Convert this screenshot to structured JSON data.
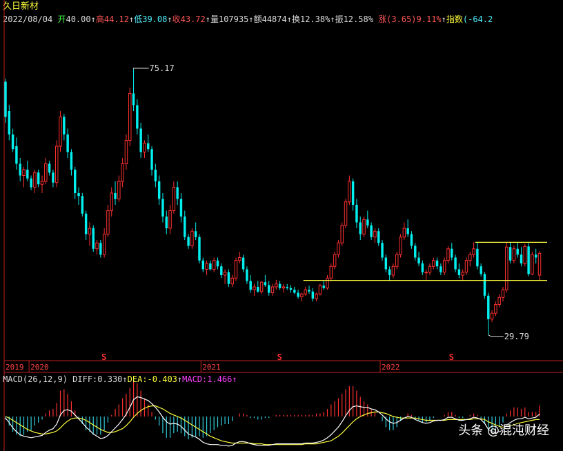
{
  "stock_name": "久日新材",
  "quote": [
    {
      "text": "2022/08/04",
      "cls": "w"
    },
    {
      "text": " 开",
      "cls": "g"
    },
    {
      "text": "40.00",
      "cls": "w"
    },
    {
      "text": "↑",
      "cls": "w"
    },
    {
      "text": "高",
      "cls": "r"
    },
    {
      "text": "44.12",
      "cls": "r"
    },
    {
      "text": "↑",
      "cls": "w"
    },
    {
      "text": "低",
      "cls": "c"
    },
    {
      "text": "39.08",
      "cls": "c"
    },
    {
      "text": "↑",
      "cls": "w"
    },
    {
      "text": "收",
      "cls": "r"
    },
    {
      "text": "43.72",
      "cls": "r"
    },
    {
      "text": "↑",
      "cls": "w"
    },
    {
      "text": "量",
      "cls": "w"
    },
    {
      "text": "107935",
      "cls": "w"
    },
    {
      "text": "↑",
      "cls": "w"
    },
    {
      "text": "额",
      "cls": "w"
    },
    {
      "text": "44874",
      "cls": "w"
    },
    {
      "text": "↑",
      "cls": "w"
    },
    {
      "text": "换",
      "cls": "w"
    },
    {
      "text": "12.38%",
      "cls": "w"
    },
    {
      "text": "↑",
      "cls": "w"
    },
    {
      "text": "振",
      "cls": "w"
    },
    {
      "text": "12.58%",
      "cls": "w"
    },
    {
      "text": " 涨",
      "cls": "r"
    },
    {
      "text": "(3.65)9.11%",
      "cls": "r"
    },
    {
      "text": "↑",
      "cls": "w"
    },
    {
      "text": "指数",
      "cls": "y"
    },
    {
      "text": "(-64.2",
      "cls": "c"
    }
  ],
  "macd_header": [
    {
      "text": "MACD(26,12,9)",
      "cls": "w"
    },
    {
      "text": " DIFF:0.330",
      "cls": "w"
    },
    {
      "text": "↑",
      "cls": "w"
    },
    {
      "text": "DEA:-0.403",
      "cls": "y"
    },
    {
      "text": "↑",
      "cls": "w"
    },
    {
      "text": "MACD:1.466",
      "cls": "m"
    },
    {
      "text": "↑",
      "cls": "m"
    }
  ],
  "watermark": "头条 @混沌财经",
  "colors": {
    "up": "#ff3030",
    "down": "#00f0f0",
    "dea": "#ffff3c",
    "diff": "#ffffff",
    "axis": "#c02020",
    "support": "#ffff3c",
    "hist_up": "#ff3030",
    "hist_down": "#30d0e0"
  },
  "chart_data": {
    "type": "candlestick",
    "annotations": {
      "high_label": "75.17",
      "low_label": "29.79"
    },
    "year_labels": [
      "2019",
      "2020",
      "2021",
      "2022"
    ],
    "signal_glyph": "S",
    "price_range": [
      26,
      82
    ],
    "horizontal_lines": [
      {
        "value": 39.1,
        "from_index": 82
      },
      {
        "value": 45.6,
        "from_index": 129
      }
    ],
    "candles": [
      [
        73,
        73.5,
        66,
        67
      ],
      [
        68,
        69,
        63,
        64
      ],
      [
        64,
        65,
        61,
        61.5
      ],
      [
        62,
        63.5,
        58,
        59
      ],
      [
        59,
        60,
        56,
        57
      ],
      [
        57,
        58.5,
        55,
        58
      ],
      [
        58,
        59.5,
        56,
        56.5
      ],
      [
        56.5,
        57,
        54.5,
        55
      ],
      [
        55,
        58,
        54,
        57.5
      ],
      [
        57.5,
        58,
        55,
        55.5
      ],
      [
        55.5,
        57,
        54,
        56
      ],
      [
        56,
        60,
        55.5,
        59
      ],
      [
        59,
        59.5,
        57,
        57.5
      ],
      [
        57.5,
        58,
        55,
        55.8
      ],
      [
        55.8,
        63,
        55,
        62
      ],
      [
        62,
        68,
        61,
        67
      ],
      [
        67,
        67.5,
        63,
        64
      ],
      [
        64,
        65,
        60,
        61
      ],
      [
        61,
        61.5,
        57,
        58
      ],
      [
        58,
        58.5,
        53,
        54
      ],
      [
        54,
        55,
        52,
        53.5
      ],
      [
        53.5,
        54,
        50,
        50.5
      ],
      [
        50.5,
        51,
        46,
        47
      ],
      [
        47,
        49,
        45,
        48
      ],
      [
        48,
        48.5,
        44,
        44.5
      ],
      [
        44.5,
        46,
        43.5,
        45.5
      ],
      [
        45.5,
        46,
        43,
        43.5
      ],
      [
        43.5,
        48,
        43,
        47
      ],
      [
        47,
        52,
        46.5,
        51
      ],
      [
        51,
        55,
        50,
        54
      ],
      [
        54,
        56,
        52,
        53
      ],
      [
        53,
        57,
        52.5,
        56
      ],
      [
        56,
        60,
        55,
        59
      ],
      [
        59,
        64,
        58,
        63
      ],
      [
        63,
        72,
        62,
        71
      ],
      [
        71,
        75.17,
        68,
        69
      ],
      [
        69,
        70,
        64,
        65
      ],
      [
        65,
        66,
        60,
        61
      ],
      [
        61,
        63,
        60,
        62.5
      ],
      [
        62.5,
        64,
        61,
        61.5
      ],
      [
        61.5,
        62,
        57,
        58
      ],
      [
        58,
        59,
        55,
        56
      ],
      [
        56,
        57,
        52,
        53
      ],
      [
        53,
        54,
        49,
        50
      ],
      [
        50,
        51,
        47,
        48
      ],
      [
        48,
        52,
        47,
        51
      ],
      [
        51,
        56,
        50.5,
        55
      ],
      [
        55,
        56,
        52,
        53
      ],
      [
        53,
        54,
        49,
        50
      ],
      [
        50,
        51,
        46,
        46.5
      ],
      [
        46.5,
        47,
        44.5,
        45
      ],
      [
        45,
        48,
        44.5,
        47.5
      ],
      [
        47.5,
        49,
        46,
        46.5
      ],
      [
        46.5,
        47,
        42,
        42.5
      ],
      [
        42.5,
        43,
        40.5,
        41
      ],
      [
        41,
        42.5,
        40,
        42
      ],
      [
        42,
        42.5,
        40.8,
        41
      ],
      [
        41,
        43,
        40.5,
        42.5
      ],
      [
        42.5,
        43,
        41,
        41.5
      ],
      [
        41.5,
        42,
        39.5,
        40
      ],
      [
        40,
        41,
        38.5,
        40.5
      ],
      [
        40.5,
        41,
        38,
        38.5
      ],
      [
        38.5,
        40,
        38,
        39.5
      ],
      [
        39.5,
        43,
        39,
        42.5
      ],
      [
        42.5,
        44,
        42,
        43
      ],
      [
        43,
        43.5,
        40.5,
        41
      ],
      [
        41,
        41.5,
        38.5,
        39
      ],
      [
        39,
        40,
        37,
        37.5
      ],
      [
        37.5,
        38.5,
        36.5,
        38
      ],
      [
        38,
        39,
        37,
        37.2
      ],
      [
        37.2,
        39,
        36.8,
        38.8
      ],
      [
        38.8,
        40,
        38,
        38.3
      ],
      [
        38.3,
        39,
        36.5,
        37
      ],
      [
        37,
        38.5,
        36.5,
        38
      ],
      [
        38,
        39.2,
        37.5,
        38.5
      ],
      [
        38.5,
        39,
        37.5,
        37.8
      ],
      [
        37.8,
        38.5,
        37,
        38
      ],
      [
        38,
        38.5,
        37.5,
        37.8
      ],
      [
        37.8,
        38.3,
        37,
        37.5
      ],
      [
        37.5,
        38,
        36.8,
        37
      ],
      [
        37,
        37.5,
        36,
        36.3
      ],
      [
        36.3,
        37,
        35.5,
        36.8
      ],
      [
        36.8,
        38,
        36.5,
        37.5
      ],
      [
        37.5,
        38.2,
        36.8,
        37.2
      ],
      [
        37.2,
        37.8,
        35.5,
        36
      ],
      [
        36,
        37,
        35.5,
        36.8
      ],
      [
        36.8,
        38.5,
        36.5,
        38.2
      ],
      [
        38.2,
        39,
        37.5,
        37.8
      ],
      [
        37.8,
        40,
        37.5,
        39.5
      ],
      [
        39.5,
        42,
        39,
        41.5
      ],
      [
        41.5,
        44,
        41,
        43.5
      ],
      [
        43.5,
        46,
        43,
        45.5
      ],
      [
        45.5,
        49,
        45,
        48.5
      ],
      [
        48.5,
        53,
        48,
        52.5
      ],
      [
        52.5,
        57,
        52,
        56
      ],
      [
        56,
        56.5,
        51,
        52
      ],
      [
        52,
        53,
        48,
        49
      ],
      [
        49,
        50,
        46,
        47
      ],
      [
        47,
        50,
        46.5,
        49.5
      ],
      [
        49.5,
        51,
        48,
        48.5
      ],
      [
        48.5,
        49,
        46,
        46.5
      ],
      [
        46.5,
        48,
        45.5,
        47.5
      ],
      [
        47.5,
        48,
        45,
        45.5
      ],
      [
        45.5,
        46,
        42.5,
        43
      ],
      [
        43,
        43.5,
        40.5,
        41
      ],
      [
        41,
        41.5,
        39,
        40
      ],
      [
        40,
        42,
        39.5,
        41.5
      ],
      [
        41.5,
        44,
        41,
        43.5
      ],
      [
        43.5,
        47,
        43,
        46.5
      ],
      [
        46.5,
        49,
        46,
        48
      ],
      [
        48,
        49.5,
        46.5,
        47
      ],
      [
        47,
        47.5,
        44.5,
        45
      ],
      [
        45,
        45.5,
        42.5,
        43
      ],
      [
        43,
        44,
        41.5,
        42
      ],
      [
        42,
        42.5,
        40,
        40.5
      ],
      [
        40.5,
        41,
        39.2,
        40.5
      ],
      [
        40.5,
        42,
        40,
        41.5
      ],
      [
        41.5,
        43,
        41,
        42.5
      ],
      [
        42.5,
        43,
        41,
        41.5
      ],
      [
        41.5,
        42,
        40,
        40.5
      ],
      [
        40.5,
        43,
        40,
        42.5
      ],
      [
        42.5,
        45,
        42,
        44.5
      ],
      [
        44.5,
        45.5,
        42.5,
        43
      ],
      [
        43,
        43.5,
        40.5,
        41
      ],
      [
        41,
        42,
        39.5,
        40
      ],
      [
        40,
        41,
        39,
        40.5
      ],
      [
        40.5,
        43,
        40,
        42.5
      ],
      [
        42.5,
        44,
        41.5,
        43.5
      ],
      [
        43.5,
        45.6,
        43,
        44.5
      ],
      [
        44.5,
        45.6,
        41,
        41.5
      ],
      [
        41.5,
        42,
        39.8,
        40.2
      ],
      [
        40.2,
        40.5,
        36,
        36.5
      ],
      [
        36.5,
        37,
        29.79,
        32.5
      ],
      [
        32.5,
        34,
        32,
        33.5
      ],
      [
        33.5,
        35.5,
        33,
        35
      ],
      [
        35,
        36.8,
        34.5,
        36.2
      ],
      [
        36.2,
        38,
        35.5,
        37.5
      ],
      [
        37.5,
        45.6,
        37,
        44.8
      ],
      [
        44.8,
        45.6,
        42,
        42.5
      ],
      [
        42.5,
        45,
        42,
        44.5
      ],
      [
        44.5,
        45.6,
        43,
        43.5
      ],
      [
        43.5,
        44.8,
        41.5,
        42
      ],
      [
        42,
        45.3,
        41.5,
        44.9
      ],
      [
        44.9,
        45.5,
        39.8,
        40.2
      ],
      [
        40.2,
        44,
        40,
        43.5
      ],
      [
        43.5,
        44.5,
        42,
        43
      ],
      [
        40,
        44.12,
        39.08,
        43.72
      ]
    ],
    "macd": {
      "diff": [
        -0.2,
        -0.8,
        -1.5,
        -2.0,
        -2.4,
        -2.6,
        -2.7,
        -2.8,
        -2.7,
        -2.6,
        -2.5,
        -2.1,
        -1.8,
        -1.6,
        -1.0,
        0.2,
        0.8,
        0.9,
        0.7,
        0.2,
        -0.3,
        -0.8,
        -1.4,
        -1.8,
        -2.3,
        -2.6,
        -2.9,
        -2.8,
        -2.5,
        -2.0,
        -1.5,
        -1.0,
        -0.4,
        0.3,
        1.2,
        2.2,
        2.6,
        2.5,
        2.3,
        2.1,
        1.7,
        1.2,
        0.6,
        -0.1,
        -0.7,
        -1.0,
        -0.9,
        -1.0,
        -1.3,
        -1.8,
        -2.3,
        -2.5,
        -2.7,
        -3.0,
        -3.4,
        -3.6,
        -3.7,
        -3.7,
        -3.7,
        -3.8,
        -3.8,
        -3.9,
        -3.8,
        -3.5,
        -3.3,
        -3.3,
        -3.4,
        -3.6,
        -3.7,
        -3.8,
        -3.8,
        -3.8,
        -3.8,
        -3.7,
        -3.6,
        -3.6,
        -3.6,
        -3.6,
        -3.6,
        -3.6,
        -3.6,
        -3.6,
        -3.5,
        -3.5,
        -3.5,
        -3.4,
        -3.3,
        -3.1,
        -2.8,
        -2.4,
        -1.9,
        -1.4,
        -0.7,
        0.1,
        0.8,
        1.3,
        1.4,
        1.3,
        1.2,
        1.2,
        1.0,
        0.9,
        0.6,
        0.2,
        -0.3,
        -0.7,
        -0.9,
        -0.8,
        -0.5,
        -0.2,
        0.0,
        -0.1,
        -0.4,
        -0.6,
        -0.8,
        -0.9,
        -0.8,
        -0.6,
        -0.5,
        -0.5,
        -0.4,
        -0.1,
        -0.1,
        -0.3,
        -0.5,
        -0.5,
        -0.4,
        -0.3,
        -0.1,
        -0.2,
        -0.4,
        -0.9,
        -1.7,
        -2.0,
        -2.1,
        -2.0,
        -1.8,
        -1.1,
        -0.8,
        -0.5,
        -0.3,
        -0.3,
        -0.1,
        -0.3,
        -0.2,
        -0.1,
        0.33
      ],
      "dea": [
        0.0,
        -0.2,
        -0.5,
        -0.8,
        -1.1,
        -1.4,
        -1.7,
        -1.9,
        -2.1,
        -2.2,
        -2.3,
        -2.3,
        -2.2,
        -2.1,
        -1.9,
        -1.5,
        -1.0,
        -0.6,
        -0.3,
        -0.2,
        -0.2,
        -0.3,
        -0.5,
        -0.8,
        -1.1,
        -1.4,
        -1.7,
        -1.9,
        -2.1,
        -2.1,
        -2.0,
        -1.8,
        -1.6,
        -1.2,
        -0.7,
        -0.1,
        0.4,
        0.8,
        1.1,
        1.3,
        1.4,
        1.4,
        1.2,
        1.0,
        0.7,
        0.4,
        0.2,
        0.0,
        -0.2,
        -0.5,
        -0.8,
        -1.1,
        -1.4,
        -1.7,
        -2.0,
        -2.3,
        -2.6,
        -2.8,
        -3.0,
        -3.2,
        -3.3,
        -3.4,
        -3.5,
        -3.5,
        -3.5,
        -3.5,
        -3.5,
        -3.5,
        -3.6,
        -3.6,
        -3.6,
        -3.7,
        -3.7,
        -3.7,
        -3.7,
        -3.7,
        -3.7,
        -3.7,
        -3.7,
        -3.7,
        -3.7,
        -3.7,
        -3.6,
        -3.6,
        -3.6,
        -3.6,
        -3.5,
        -3.4,
        -3.3,
        -3.2,
        -2.9,
        -2.6,
        -2.2,
        -1.7,
        -1.2,
        -0.7,
        -0.3,
        0.0,
        0.2,
        0.4,
        0.5,
        0.6,
        0.6,
        0.5,
        0.4,
        0.2,
        0.0,
        -0.1,
        -0.2,
        -0.2,
        -0.2,
        -0.2,
        -0.2,
        -0.3,
        -0.4,
        -0.5,
        -0.5,
        -0.5,
        -0.5,
        -0.5,
        -0.5,
        -0.4,
        -0.4,
        -0.4,
        -0.4,
        -0.4,
        -0.4,
        -0.4,
        -0.3,
        -0.3,
        -0.3,
        -0.4,
        -0.7,
        -0.9,
        -1.1,
        -1.3,
        -1.4,
        -1.3,
        -1.2,
        -1.1,
        -0.9,
        -0.8,
        -0.7,
        -0.6,
        -0.5,
        -0.4,
        -0.403
      ]
    }
  }
}
